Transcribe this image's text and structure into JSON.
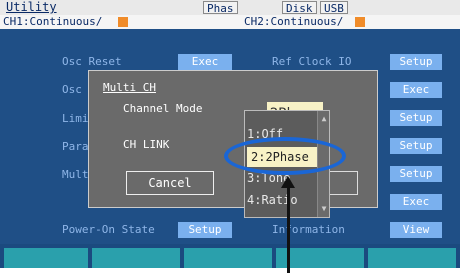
{
  "title": "Utility",
  "tags": {
    "phas": "Phas",
    "disk": "Disk",
    "usb": "USB"
  },
  "channels": {
    "ch1": "CH1:Continuous/",
    "ch2": "CH2:Continuous/"
  },
  "menu": {
    "osc_reset": "Osc Reset",
    "osc_reset_btn": "Exec",
    "ref_clock": "Ref Clock IO",
    "setup_label": "Setup",
    "osc": "Osc",
    "limi": "Limi",
    "para": "Para",
    "mult": "Mult",
    "exec_label": "Exec",
    "power_on": "Power-On State",
    "power_on_btn": "Setup",
    "information": "Information",
    "view_label": "View"
  },
  "dialog": {
    "title": "Multi CH",
    "channel_mode": "Channel Mode",
    "ch_link": "CH LINK",
    "cancel": "Cancel",
    "phase_value": "2Phase"
  },
  "dropdown": {
    "items": [
      "1:Off",
      "2:2Phase",
      "3:Tone",
      "4:Ratio"
    ],
    "selected": "2:2Phase"
  },
  "colors": {
    "bg": "#1f4f86",
    "button": "#7ab0ee",
    "accent": "#f08c2a",
    "highlight": "#f8f2c6",
    "softkey": "#2aa0ac",
    "annotation": "#1a66d6"
  }
}
